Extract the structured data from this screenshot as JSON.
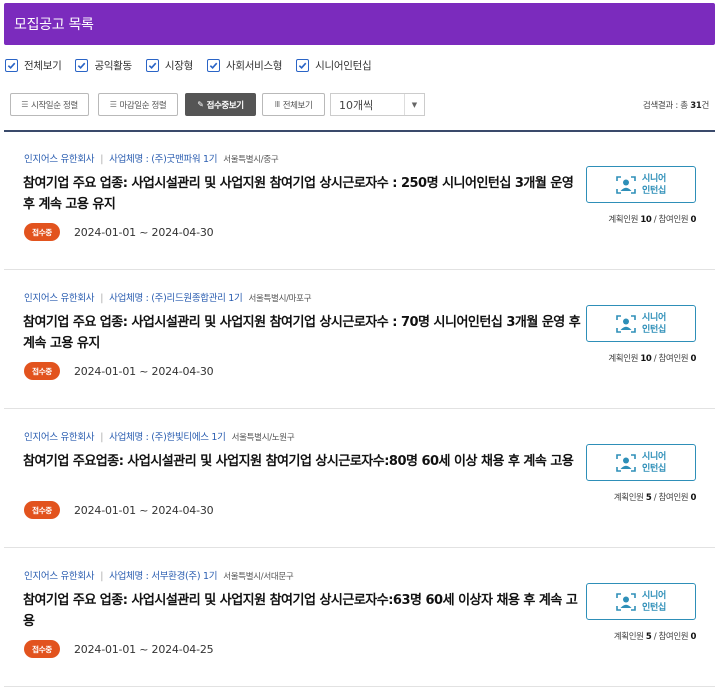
{
  "header": {
    "title": "모집공고 목록"
  },
  "filters": [
    {
      "label": "전체보기",
      "checked": true
    },
    {
      "label": "공익활동",
      "checked": true
    },
    {
      "label": "시장형",
      "checked": true
    },
    {
      "label": "사회서비스형",
      "checked": true
    },
    {
      "label": "시니어인턴십",
      "checked": true
    }
  ],
  "toolbar": {
    "sort_start": "시작일순 정렬",
    "sort_end": "마감일순 정렬",
    "view_open": "접수중보기",
    "view_all": "전체보기",
    "page_size": "10개씩",
    "result_prefix": "검색결과 : 총 ",
    "result_count": "31",
    "result_suffix": "건"
  },
  "labels": {
    "apply_line1": "시니어",
    "apply_line2": "인턴십",
    "planned_label": "계획인원",
    "participants_label": "참여인원",
    "slash": " / "
  },
  "listings": [
    {
      "org": "인지어스 유한회사",
      "business": "사업체명 : (주)굿맨파워 1기",
      "location": "서울특별시/중구",
      "headline": "참여기업 주요 업종: 사업시설관리 및 사업지원 참여기업 상시근로자수 : 250명 시니어인턴십 3개월 운영 후 계속 고용 유지",
      "status": "접수중",
      "period": "2024-01-01 ~ 2024-04-30",
      "planned": "10",
      "participants": "0"
    },
    {
      "org": "인지어스 유한회사",
      "business": "사업체명 : (주)리드원종합관리 1기",
      "location": "서울특별시/마포구",
      "headline": "참여기업 주요 업종: 사업시설관리 및 사업지원 참여기업 상시근로자수 : 70명 시니어인턴십 3개월 운영 후 계속 고용 유지",
      "status": "접수중",
      "period": "2024-01-01 ~ 2024-04-30",
      "planned": "10",
      "participants": "0"
    },
    {
      "org": "인지어스 유한회사",
      "business": "사업체명 : (주)한빛티에스 1기",
      "location": "서울특별시/노원구",
      "headline": "참여기업 주요업종: 사업시설관리 및 사업지원 참여기업 상시근로자수:80명 60세 이상 채용 후 계속 고용",
      "status": "접수중",
      "period": "2024-01-01 ~ 2024-04-30",
      "planned": "5",
      "participants": "0"
    },
    {
      "org": "인지어스 유한회사",
      "business": "사업체명 : 서부환경(주) 1기",
      "location": "서울특별시/서대문구",
      "headline": "참여기업 주요 업종: 사업시설관리 및 사업지원 참여기업 상시근로자수:63명 60세 이상자 채용 후 계속 고용",
      "status": "접수중",
      "period": "2024-01-01 ~ 2024-04-25",
      "planned": "5",
      "participants": "0"
    }
  ]
}
